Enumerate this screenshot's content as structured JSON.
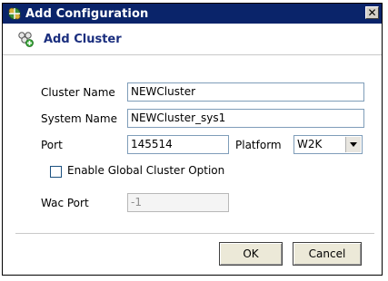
{
  "window": {
    "title": "Add Configuration",
    "close_glyph": "✕"
  },
  "header": {
    "title": "Add Cluster",
    "icon": "add-cluster-icon"
  },
  "form": {
    "cluster_name": {
      "label": "Cluster Name",
      "value": "NEWCluster"
    },
    "system_name": {
      "label": "System Name",
      "value": "NEWCluster_sys1"
    },
    "port": {
      "label": "Port",
      "value": "145514"
    },
    "platform": {
      "label": "Platform",
      "value": "W2K"
    },
    "global_cluster": {
      "label": "Enable Global Cluster Option",
      "checked": false
    },
    "wac_port": {
      "label": "Wac Port",
      "value": "-1",
      "disabled": true
    }
  },
  "buttons": {
    "ok": "OK",
    "cancel": "Cancel"
  },
  "colors": {
    "titlebar": "#0a246a",
    "header_text": "#1a2e7e"
  }
}
